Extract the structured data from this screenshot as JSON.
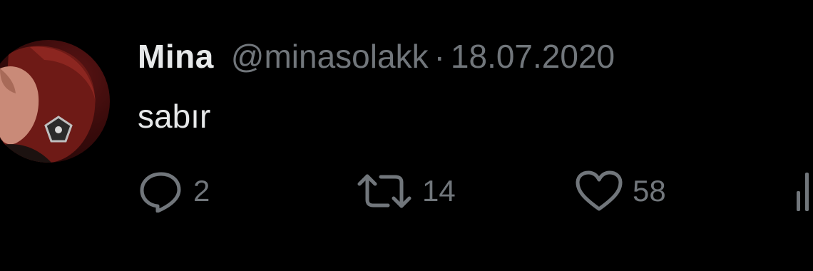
{
  "tweet": {
    "author": {
      "name": "Mina",
      "handle": "@minasolakk"
    },
    "separator": "·",
    "date": "18.07.2020",
    "text": "sabır",
    "actions": {
      "reply": {
        "icon": "reply-icon",
        "count": "2"
      },
      "retweet": {
        "icon": "retweet-icon",
        "count": "14"
      },
      "like": {
        "icon": "heart-icon",
        "count": "58"
      },
      "share": {
        "icon": "stats-icon"
      }
    }
  },
  "colors": {
    "background": "#000000",
    "primary_text": "#e7e9ea",
    "secondary_text": "#71767b"
  }
}
